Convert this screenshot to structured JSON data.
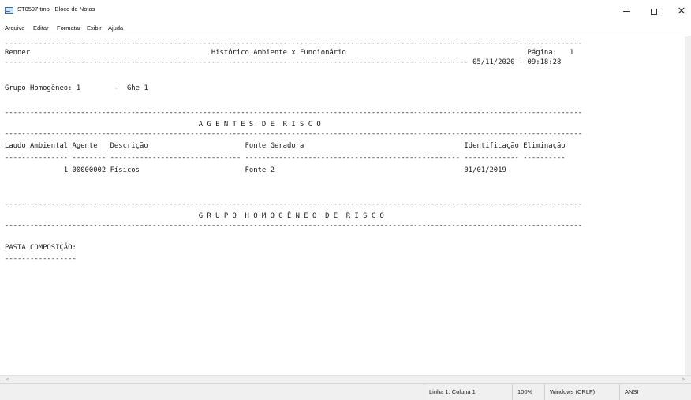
{
  "window": {
    "title": "ST0597.tmp - Bloco de Notas",
    "icon": "notepad-icon",
    "controls": {
      "minimize": "minimize-icon",
      "maximize": "maximize-icon",
      "close": "close-icon"
    }
  },
  "menu": [
    "Arquivo",
    "Editar",
    "Formatar",
    "Exibir",
    "Ajuda"
  ],
  "document": {
    "lines": [
      "-----------------------------------------------------------------------------------------------------------------------------------------",
      "Renner                                           Histórico Ambiente x Funcionário                                           Página:   1",
      "-------------------------------------------------------------------------------------------------------------- 05/11/2020 - 09:18:28",
      "",
      "Grupo Homogêneo: 1        -  Ghe 1",
      "",
      "-----------------------------------------------------------------------------------------------------------------------------------------",
      "                                              A G E N T E S  D E  R I S C O",
      "-----------------------------------------------------------------------------------------------------------------------------------------",
      "Laudo Ambiental Agente   Descrição                       Fonte Geradora                                      Identificação Eliminação",
      "--------------- -------- ------------------------------- --------------------------------------------------- ------------- ----------",
      "              1 00000002 Físicos                         Fonte 2                                             01/01/2019",
      "",
      "",
      "-----------------------------------------------------------------------------------------------------------------------------------------",
      "                                              G R U P O  H O M O G Ê N E O  D E  R I S C O",
      "-----------------------------------------------------------------------------------------------------------------------------------------",
      "",
      "PASTA COMPOSIÇÃO:",
      "-----------------"
    ]
  },
  "status": {
    "position": "Linha 1, Coluna 1",
    "zoom": "100%",
    "line_endings": "Windows (CRLF)",
    "encoding": "ANSI"
  }
}
